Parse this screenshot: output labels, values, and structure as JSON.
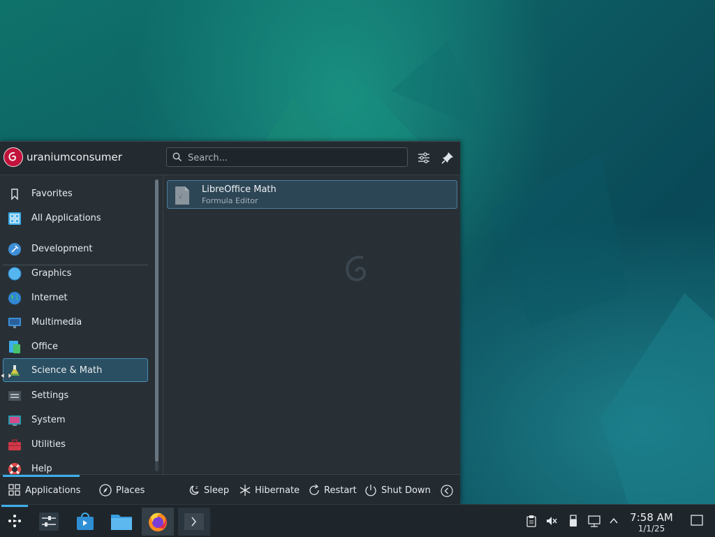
{
  "user": {
    "name": "uraniumconsumer"
  },
  "search": {
    "placeholder": "Search..."
  },
  "categories": [
    {
      "label": "Favorites",
      "icon": "bookmark-icon"
    },
    {
      "label": "All Applications",
      "icon": "grid-icon"
    },
    {
      "label": "Development",
      "icon": "development-icon"
    },
    {
      "label": "Graphics",
      "icon": "graphics-icon"
    },
    {
      "label": "Internet",
      "icon": "globe-icon"
    },
    {
      "label": "Multimedia",
      "icon": "multimedia-icon"
    },
    {
      "label": "Office",
      "icon": "office-icon"
    },
    {
      "label": "Science & Math",
      "icon": "flask-icon",
      "selected": true
    },
    {
      "label": "Settings",
      "icon": "settings-icon"
    },
    {
      "label": "System",
      "icon": "system-icon"
    },
    {
      "label": "Utilities",
      "icon": "toolbox-icon"
    },
    {
      "label": "Help",
      "icon": "lifebuoy-icon"
    }
  ],
  "results": [
    {
      "name": "LibreOffice Math",
      "description": "Formula Editor",
      "icon": "libreoffice-math-icon"
    }
  ],
  "footer": {
    "tabs": [
      {
        "label": "Applications",
        "icon": "grid-icon",
        "active": true
      },
      {
        "label": "Places",
        "icon": "compass-icon"
      }
    ],
    "power": [
      {
        "label": "Sleep",
        "icon": "sleep-icon"
      },
      {
        "label": "Hibernate",
        "icon": "hibernate-icon"
      },
      {
        "label": "Restart",
        "icon": "restart-icon"
      },
      {
        "label": "Shut Down",
        "icon": "power-icon"
      }
    ]
  },
  "taskbar": {
    "apps": [
      "application-launcher",
      "system-settings",
      "discover",
      "dolphin-file-manager",
      "firefox",
      "konsole"
    ],
    "tray": [
      "clipboard-icon",
      "volume-muted-icon",
      "usb-icon",
      "network-icon",
      "expand-tray-icon"
    ],
    "clock": {
      "time": "7:58 AM",
      "date": "1/1/25"
    }
  },
  "colors": {
    "accent": "#3daee9",
    "panel": "#283036",
    "selection": "#2b4f62",
    "debian_red": "#c1123c"
  }
}
